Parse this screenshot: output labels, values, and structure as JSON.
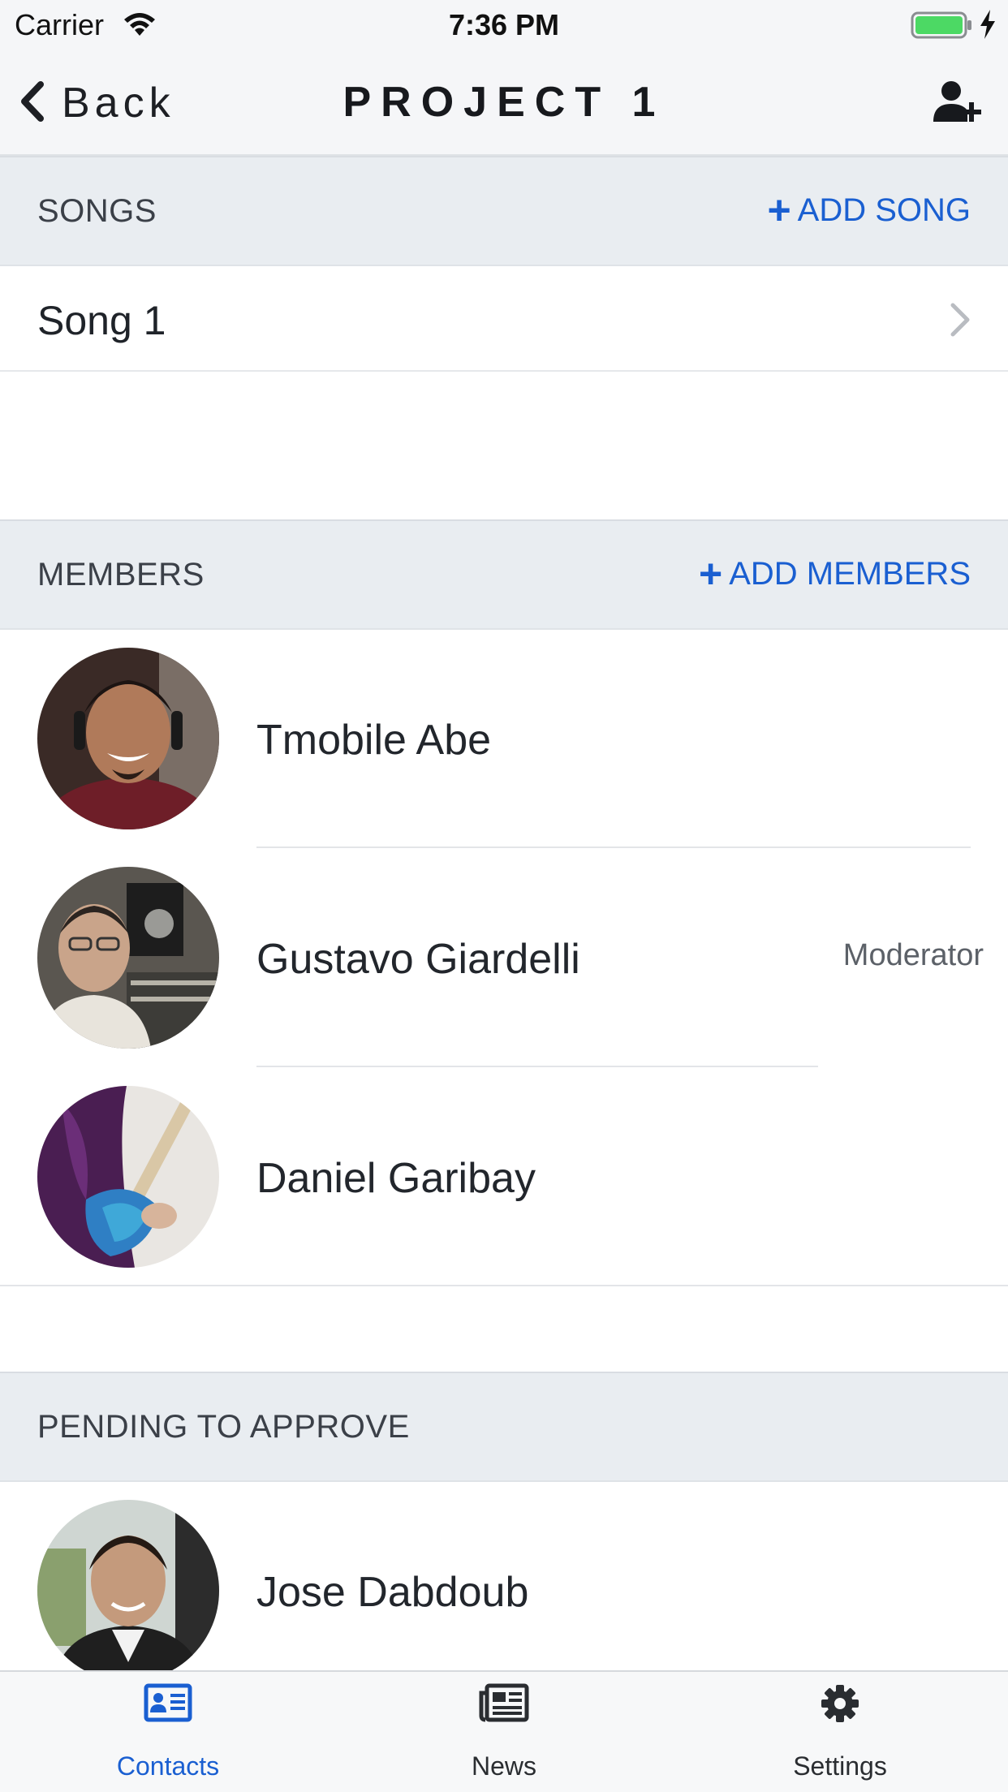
{
  "status_bar": {
    "carrier": "Carrier",
    "time": "7:36 PM"
  },
  "nav": {
    "back_label": "Back",
    "title": "PROJECT 1"
  },
  "songs": {
    "section_title": "SONGS",
    "add_label": "ADD SONG",
    "items": [
      {
        "title": "Song 1"
      }
    ]
  },
  "members": {
    "section_title": "MEMBERS",
    "add_label": "ADD MEMBERS",
    "items": [
      {
        "name": "Tmobile Abe",
        "role": ""
      },
      {
        "name": "Gustavo Giardelli",
        "role": "Moderator"
      },
      {
        "name": "Daniel Garibay",
        "role": ""
      }
    ]
  },
  "pending": {
    "section_title": "PENDING TO APPROVE",
    "items": [
      {
        "name": "Jose Dabdoub"
      }
    ]
  },
  "tabs": [
    {
      "label": "Contacts",
      "icon": "contact-card-icon",
      "active": true
    },
    {
      "label": "News",
      "icon": "newspaper-icon",
      "active": false
    },
    {
      "label": "Settings",
      "icon": "gear-icon",
      "active": false
    }
  ],
  "colors": {
    "accent": "#1a5fd1",
    "section_bg": "#e9edf1",
    "bar_bg": "#f5f6f8",
    "battery": "#4cd964"
  }
}
